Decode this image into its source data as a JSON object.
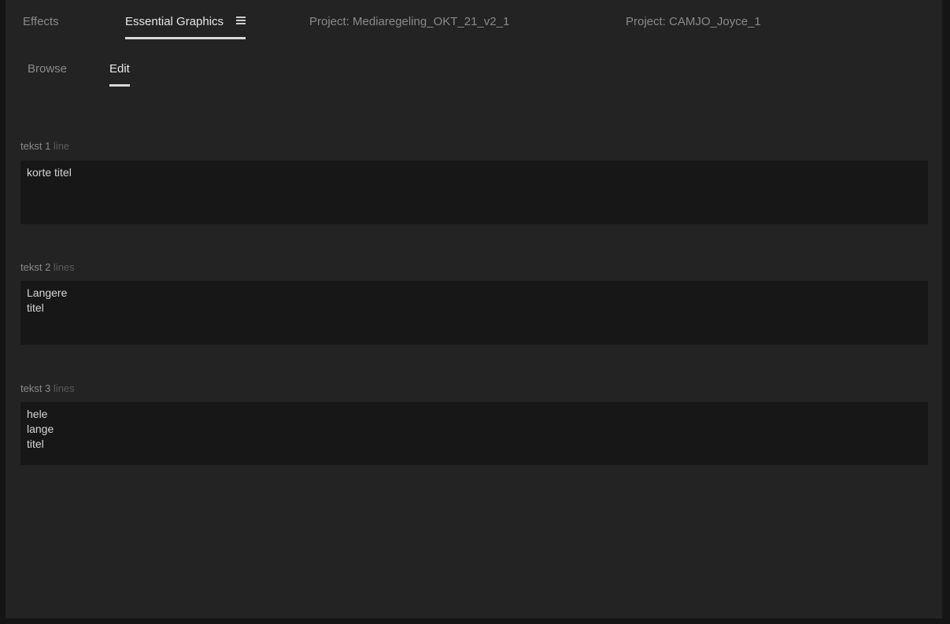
{
  "top_tabs": [
    {
      "label": "Effects",
      "active": false
    },
    {
      "label": "Essential Graphics",
      "active": true
    },
    {
      "label": "Project: Mediaregeling_OKT_21_v2_1",
      "active": false
    },
    {
      "label": "Project: CAMJO_Joyce_1",
      "active": false
    }
  ],
  "menu_icon": "hamburger-menu-icon",
  "sub_tabs": [
    {
      "label": "Browse",
      "active": false
    },
    {
      "label": "Edit",
      "active": true
    }
  ],
  "fields": [
    {
      "label_main": "tekst 1 ",
      "label_dim": "line",
      "value": "korte titel"
    },
    {
      "label_main": "tekst 2 ",
      "label_dim": "lines",
      "value": "Langere\ntitel"
    },
    {
      "label_main": "tekst 3 ",
      "label_dim": "lines",
      "value": "hele\nlange\ntitel"
    }
  ],
  "colors": {
    "panel_bg": "#232323",
    "input_bg": "#171717",
    "active_text": "#e6e6e6",
    "inactive_text": "#8a8a8a"
  }
}
